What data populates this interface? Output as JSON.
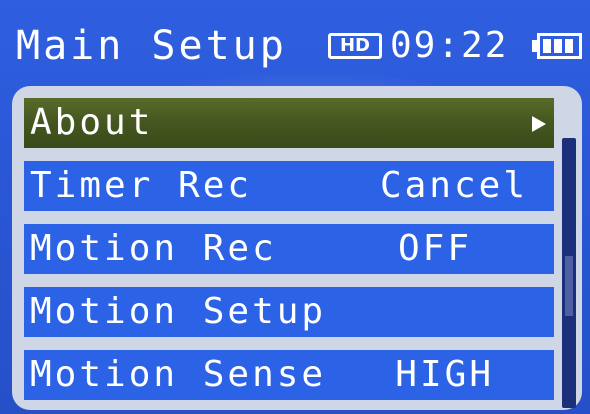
{
  "header": {
    "title": "Main Setup",
    "hd_badge": "HD",
    "time": "09:22",
    "battery_icon": "battery-full-icon"
  },
  "menu": {
    "items": [
      {
        "label": "About",
        "value": "",
        "has_submenu": true,
        "selected": true
      },
      {
        "label": "Timer Rec",
        "value": "Cancel",
        "has_submenu": false,
        "selected": false
      },
      {
        "label": "Motion Rec",
        "value": "OFF",
        "has_submenu": false,
        "selected": false
      },
      {
        "label": "Motion Setup",
        "value": "",
        "has_submenu": false,
        "selected": false
      },
      {
        "label": "Motion Sense",
        "value": "HIGH",
        "has_submenu": false,
        "selected": false
      }
    ]
  },
  "colors": {
    "background": "#2f5fe0",
    "row": "#2c63e6",
    "row_selected": "#465820",
    "panel": "#cfd6e6",
    "text": "#ffffff"
  }
}
